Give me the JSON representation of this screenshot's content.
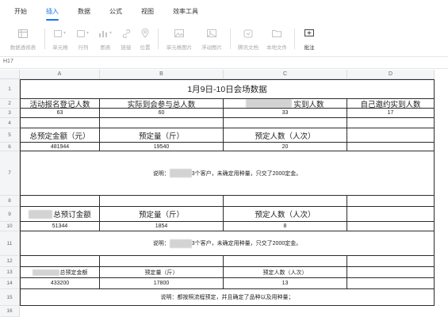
{
  "ribbon": {
    "tabs": [
      {
        "label": "开始",
        "active": false
      },
      {
        "label": "插入",
        "active": true
      },
      {
        "label": "数据",
        "active": false
      },
      {
        "label": "公式",
        "active": false
      },
      {
        "label": "视图",
        "active": false
      },
      {
        "label": "效率工具",
        "active": false
      }
    ],
    "tools": [
      {
        "label": "数据透视表",
        "icon": "pivot-table-icon"
      },
      {
        "label": "单元格",
        "icon": "cells-icon"
      },
      {
        "label": "行列",
        "icon": "rows-columns-icon"
      },
      {
        "label": "图表",
        "icon": "chart-icon"
      },
      {
        "label": "链接",
        "icon": "link-icon"
      },
      {
        "label": "位置",
        "icon": "location-icon"
      },
      {
        "label": "单元格图片",
        "icon": "cell-image-icon"
      },
      {
        "label": "浮动图片",
        "icon": "floating-image-icon"
      },
      {
        "label": "腾讯文档",
        "icon": "tencent-doc-icon"
      },
      {
        "label": "本地文件",
        "icon": "folder-icon"
      },
      {
        "label": "批注",
        "icon": "comment-icon"
      }
    ]
  },
  "name_box": "H17",
  "columns": [
    "A",
    "B",
    "C",
    "D"
  ],
  "rows": [
    "1",
    "2",
    "3",
    "4",
    "5",
    "6",
    "7",
    "8",
    "9",
    "10",
    "11",
    "12",
    "13",
    "14",
    "15",
    "16"
  ],
  "sheet": {
    "title": "1月9日-10日会场数据",
    "r2": {
      "a": "活动报名登记人数",
      "b": "实际到会参与总人数",
      "c": "实到人数",
      "d": "自己邀约实到人数"
    },
    "r3": {
      "a": "63",
      "b": "60",
      "c": "33",
      "d": "17"
    },
    "r5": {
      "a": "总预定金额（元）",
      "b": "预定量（斤）",
      "c": "预定人数（人次）"
    },
    "r6": {
      "a": "481944",
      "b": "19540",
      "c": "20"
    },
    "r7_note_prefix": "说明：",
    "r7_note_suffix": "3个客户，未确定用种量，只交了2000定金。",
    "r9": {
      "a": "总预订金额",
      "b": "预定量（斤）",
      "c": "预定人数（人次）"
    },
    "r10": {
      "a": "51344",
      "b": "1854",
      "c": "8"
    },
    "r11_note_prefix": "说明：",
    "r11_note_suffix": "3个客户，未确定用种量，只交了2000定金。",
    "r13": {
      "a": "总预定金额",
      "b": "预定量（斤）",
      "c": "预定人数（人次）"
    },
    "r14": {
      "a": "433200",
      "b": "17800",
      "c": "13"
    },
    "r15_note": "说明：都按照流程预定，并且确定了品种以及用种量；"
  },
  "colors": {
    "accent": "#1a73e8",
    "grid_border": "#2b2b2b",
    "header_bg": "#f4f5f7"
  }
}
